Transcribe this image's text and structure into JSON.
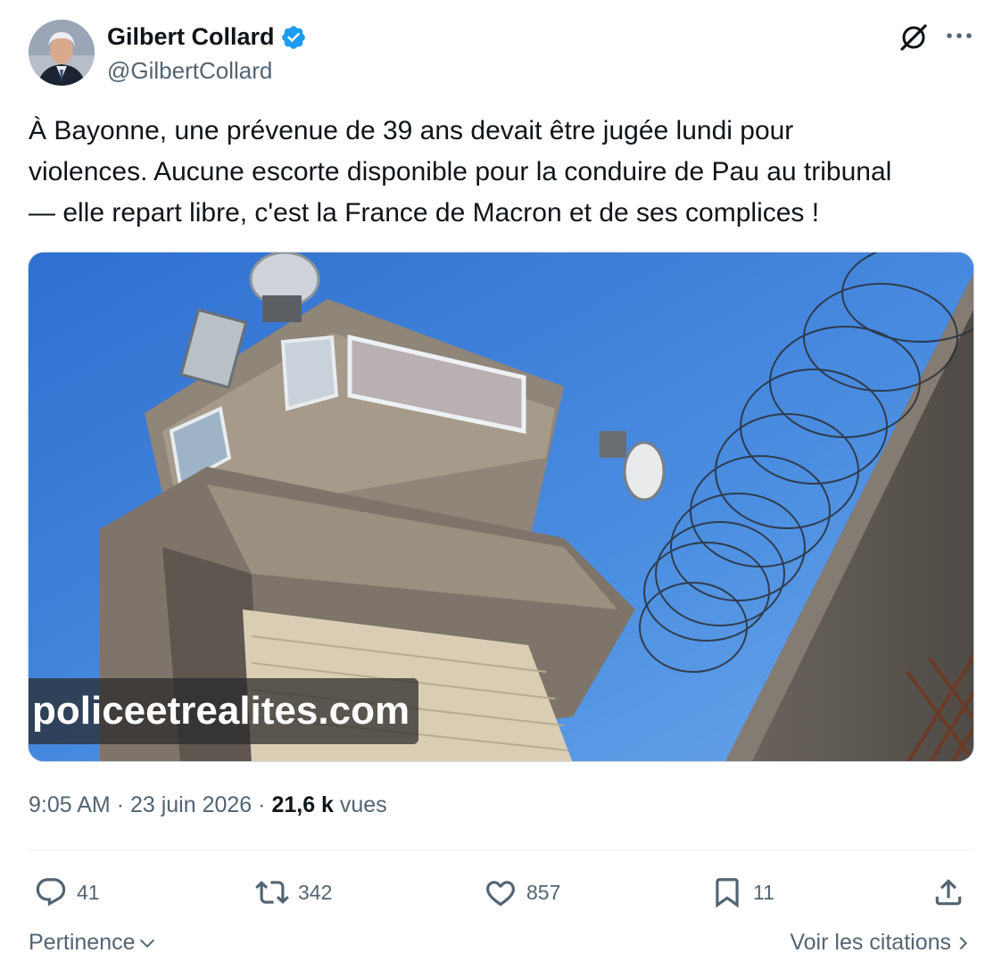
{
  "author": {
    "display_name": "Gilbert Collard",
    "handle": "@GilbertCollard",
    "verified": true,
    "verified_color": "#1d9bf0"
  },
  "header_icons": {
    "grok": "grok-icon",
    "more": "more-icon"
  },
  "tweet": {
    "text": "À Bayonne, une prévenue de 39 ans devait être jugée lundi pour\nviolences. Aucune escorte disponible pour la conduire de Pau au tribunal\n— elle repart libre, c'est la France de Macron et de ses complices !"
  },
  "media": {
    "watermark": "policeetrealites.com"
  },
  "meta": {
    "time": "9:05 AM",
    "separator": "·",
    "date": "23 juin 2026",
    "views_count": "21,6 k",
    "views_label": "vues"
  },
  "actions": {
    "replies": "41",
    "reposts": "342",
    "likes": "857",
    "bookmarks": "11"
  },
  "footer": {
    "sort_label": "Pertinence",
    "quotes_label": "Voir les citations"
  },
  "colors": {
    "text": "#0f1419",
    "muted": "#536471",
    "border": "#cfd9de"
  }
}
